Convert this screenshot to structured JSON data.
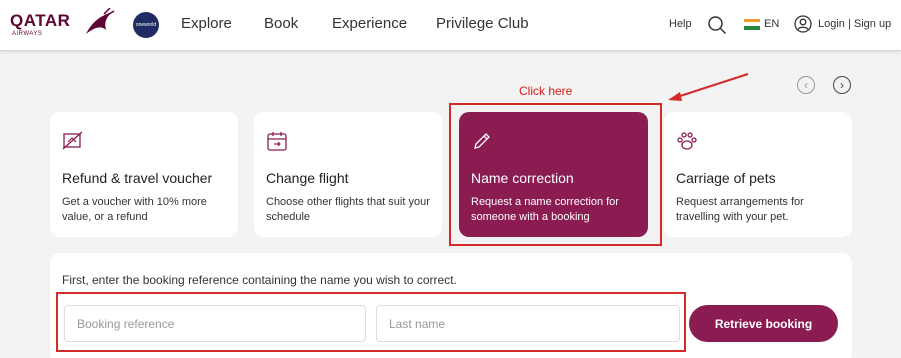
{
  "header": {
    "logo_text": "QATAR",
    "logo_sub": "AIRWAYS",
    "alliance": "oneworld",
    "nav": [
      "Explore",
      "Book",
      "Experience",
      "Privilege Club"
    ],
    "help": "Help",
    "language": "EN",
    "login": "Login | Sign up"
  },
  "annotation": {
    "click_here": "Click here"
  },
  "cards": [
    {
      "icon": "voucher-icon",
      "title": "Refund & travel voucher",
      "desc": "Get a voucher with 10% more value, or a refund"
    },
    {
      "icon": "calendar-icon",
      "title": "Change flight",
      "desc": "Choose other flights that suit your schedule"
    },
    {
      "icon": "pencil-icon",
      "title": "Name correction",
      "desc": "Request a name correction for someone with a booking"
    },
    {
      "icon": "paw-icon",
      "title": "Carriage of pets",
      "desc": "Request arrangements for travelling with your pet."
    }
  ],
  "form": {
    "instruction": "First, enter the booking reference containing the name you wish to correct.",
    "booking_ref_placeholder": "Booking reference",
    "last_name_placeholder": "Last name",
    "button": "Retrieve booking"
  },
  "colors": {
    "brand": "#8a1c52",
    "annotation": "#d42a2a"
  }
}
